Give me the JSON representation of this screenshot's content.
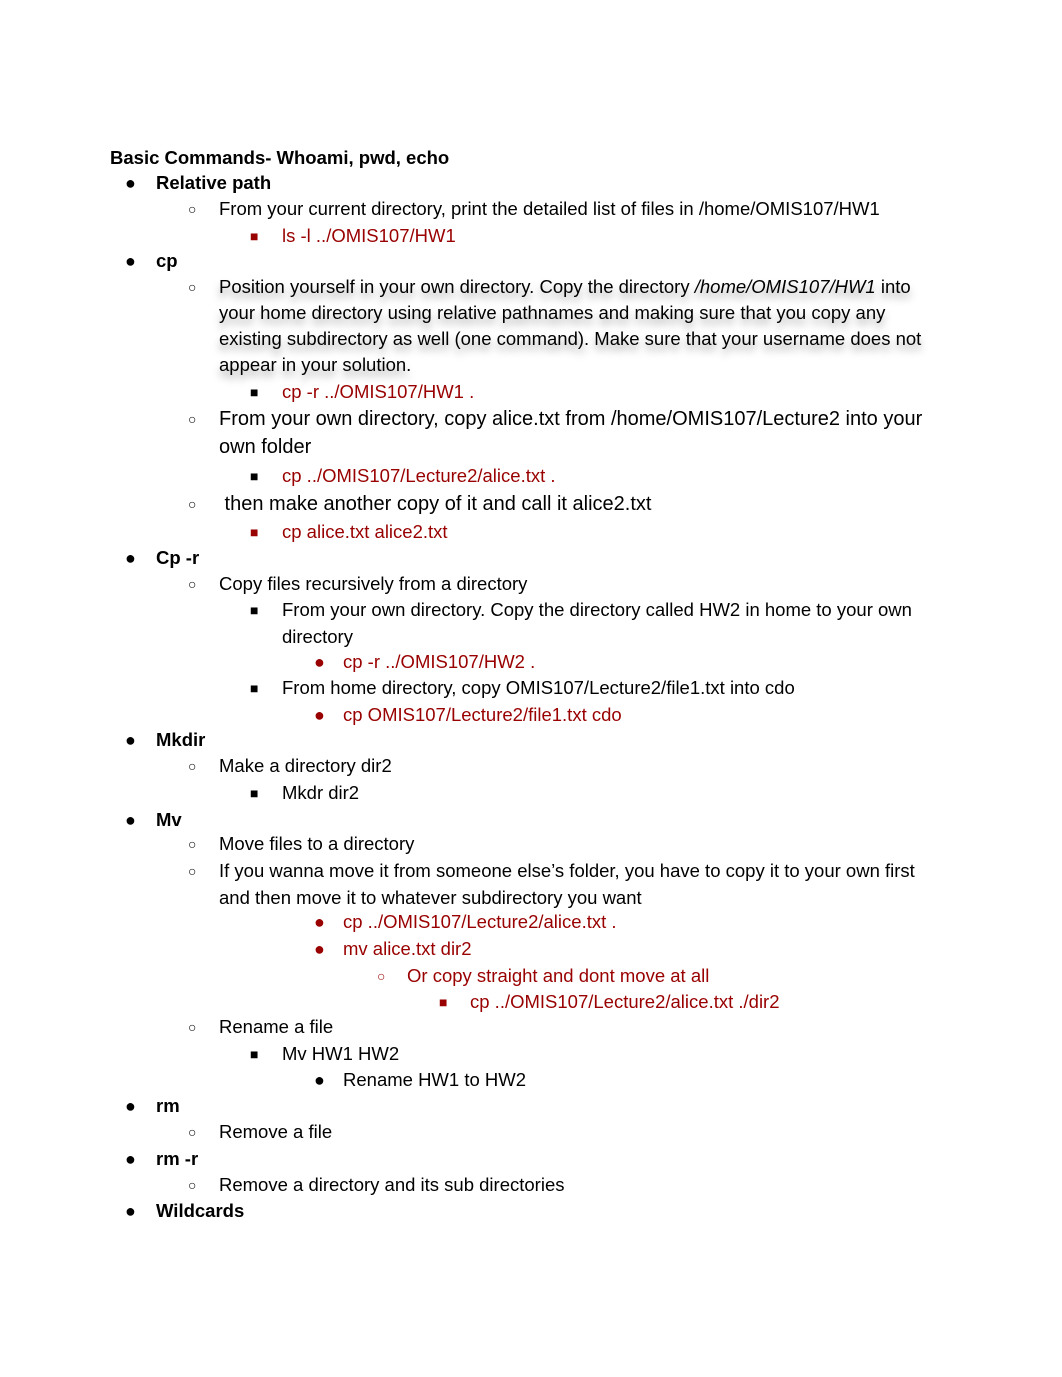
{
  "document": {
    "title": "Basic Commands- Whoami, pwd, echo",
    "sections": [
      {
        "heading": "Relative path",
        "items": [
          {
            "text": "From your current directory, print the detailed list of files in /home/OMIS107/HW1",
            "answer": "ls -l ../OMIS107/HW1"
          }
        ]
      },
      {
        "heading": "cp",
        "items": [
          {
            "text_lines": [
              "Position yourself in your own directory. Copy the directory ",
              "/home/OMIS107/HW1",
              " into",
              "your home directory using relative pathnames and making sure that you copy any",
              "existing subdirectory as well (one command). Make sure that your username does not",
              "appear in your solution."
            ],
            "answer": "cp -r ../OMIS107/HW1 ."
          },
          {
            "text_lines": [
              "From your own directory, copy alice.txt from /home/OMIS107/Lecture2 into your",
              "own folder"
            ],
            "answer": "cp ../OMIS107/Lecture2/alice.txt ."
          },
          {
            "text": " then make another copy of it and call it alice2.txt",
            "answer": "cp alice.txt alice2.txt"
          }
        ]
      },
      {
        "heading": "Cp -r",
        "items": [
          {
            "text": "Copy files recursively from a directory",
            "subitems": [
              {
                "text_lines": [
                  "From your own directory. Copy the directory called HW2 in home to your own",
                  "directory"
                ],
                "answer": "cp -r ../OMIS107/HW2 ."
              },
              {
                "text": "From home directory, copy OMIS107/Lecture2/file1.txt into cdo",
                "answer": "cp OMIS107/Lecture2/file1.txt cdo"
              }
            ]
          }
        ]
      },
      {
        "heading": "Mkdir",
        "items": [
          {
            "text": "Make a directory dir2",
            "answer": "Mkdr dir2"
          }
        ]
      },
      {
        "heading": "Mv",
        "items": [
          {
            "text": "Move files to a directory"
          },
          {
            "text_lines": [
              "If you wanna move it from someone else’s folder, you have to copy it to your own first",
              "and then move it to whatever subdirectory you want"
            ],
            "answers": [
              "cp ../OMIS107/Lecture2/alice.txt .",
              "mv alice.txt dir2"
            ],
            "alt": "Or copy straight and dont move at all",
            "alt_answer": "cp ../OMIS107/Lecture2/alice.txt ./dir2"
          },
          {
            "text": "Rename a file",
            "answer": "Mv HW1 HW2",
            "note": "Rename HW1 to HW2"
          }
        ]
      },
      {
        "heading": "rm",
        "items": [
          {
            "text": "Remove a file"
          }
        ]
      },
      {
        "heading": "rm -r",
        "items": [
          {
            "text": "Remove a directory and its sub directories"
          }
        ]
      },
      {
        "heading": "Wildcards",
        "items": []
      }
    ]
  },
  "bullets": {
    "level1": "●",
    "level2": "○",
    "level3": "■"
  },
  "colors": {
    "answer": "#990000",
    "text": "#000000"
  }
}
